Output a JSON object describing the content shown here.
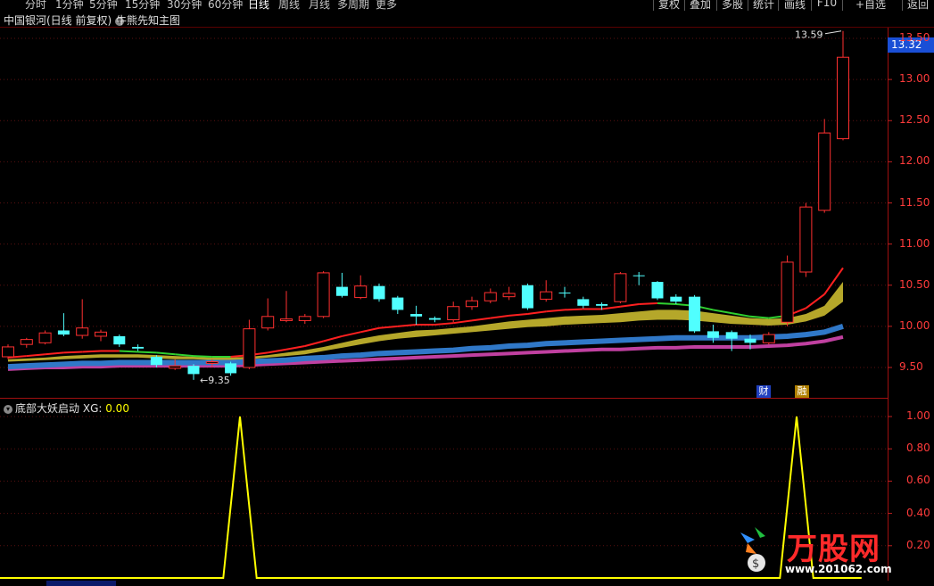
{
  "toolbar": {
    "periods": [
      "分时",
      "1分钟",
      "5分钟",
      "15分钟",
      "30分钟",
      "60分钟",
      "日线",
      "周线",
      "月线",
      "多周期",
      "更多"
    ],
    "active_period": "日线",
    "right_buttons": [
      "复权",
      "叠加",
      "多股",
      "统计",
      "画线",
      "F10",
      "+自选",
      "返回"
    ]
  },
  "main_title": "中国银河(日线 前复权)",
  "indicator_name": "牛熊先知主图",
  "price_axis": {
    "labels": [
      "13.50",
      "13.00",
      "12.50",
      "12.00",
      "11.50",
      "11.00",
      "10.50",
      "10.00",
      "9.50"
    ],
    "current_price": "13.32",
    "color": "#ff3b3b"
  },
  "annotations": {
    "high_label": "13.59",
    "low_label": "9.35",
    "tag_cai": "财",
    "tag_rong": "融"
  },
  "sub_indicator": {
    "name": "底部大妖启动",
    "xg_label": "XG:",
    "xg_value": "0.00",
    "axis_labels": [
      "1.00",
      "0.80",
      "0.60",
      "0.40",
      "0.20"
    ]
  },
  "watermark": {
    "brand": "万股网",
    "url": "www.201062.com"
  },
  "chart_data": {
    "type": "candlestick",
    "ylim": [
      9.3,
      13.65
    ],
    "candles": [
      {
        "o": 9.63,
        "c": 9.75,
        "h": 9.78,
        "l": 9.6,
        "up": true
      },
      {
        "o": 9.78,
        "c": 9.84,
        "h": 9.86,
        "l": 9.74,
        "up": true
      },
      {
        "o": 9.8,
        "c": 9.92,
        "h": 9.95,
        "l": 9.78,
        "up": true
      },
      {
        "o": 9.95,
        "c": 9.9,
        "h": 10.16,
        "l": 9.88,
        "up": false
      },
      {
        "o": 9.89,
        "c": 9.98,
        "h": 10.33,
        "l": 9.85,
        "up": true
      },
      {
        "o": 9.88,
        "c": 9.93,
        "h": 9.96,
        "l": 9.82,
        "up": true
      },
      {
        "o": 9.88,
        "c": 9.78,
        "h": 9.9,
        "l": 9.75,
        "up": false
      },
      {
        "o": 9.75,
        "c": 9.73,
        "h": 9.78,
        "l": 9.7,
        "up": false
      },
      {
        "o": 9.63,
        "c": 9.53,
        "h": 9.65,
        "l": 9.5,
        "up": false
      },
      {
        "o": 9.49,
        "c": 9.52,
        "h": 9.6,
        "l": 9.47,
        "up": true
      },
      {
        "o": 9.52,
        "c": 9.42,
        "h": 9.54,
        "l": 9.35,
        "up": false
      },
      {
        "o": 9.55,
        "c": 9.57,
        "h": 9.6,
        "l": 9.5,
        "up": true
      },
      {
        "o": 9.55,
        "c": 9.43,
        "h": 9.57,
        "l": 9.4,
        "up": false
      },
      {
        "o": 9.5,
        "c": 9.97,
        "h": 10.08,
        "l": 9.48,
        "up": true
      },
      {
        "o": 9.98,
        "c": 10.12,
        "h": 10.34,
        "l": 9.95,
        "up": true
      },
      {
        "o": 10.07,
        "c": 10.09,
        "h": 10.43,
        "l": 10.05,
        "up": true
      },
      {
        "o": 10.07,
        "c": 10.12,
        "h": 10.15,
        "l": 10.03,
        "up": true
      },
      {
        "o": 10.12,
        "c": 10.65,
        "h": 10.67,
        "l": 10.1,
        "up": true
      },
      {
        "o": 10.48,
        "c": 10.37,
        "h": 10.65,
        "l": 10.35,
        "up": false
      },
      {
        "o": 10.35,
        "c": 10.49,
        "h": 10.62,
        "l": 10.33,
        "up": true
      },
      {
        "o": 10.49,
        "c": 10.33,
        "h": 10.52,
        "l": 10.3,
        "up": false
      },
      {
        "o": 10.35,
        "c": 10.2,
        "h": 10.37,
        "l": 10.15,
        "up": false
      },
      {
        "o": 10.15,
        "c": 10.12,
        "h": 10.25,
        "l": 10.02,
        "up": false
      },
      {
        "o": 10.1,
        "c": 10.08,
        "h": 10.12,
        "l": 10.05,
        "up": false
      },
      {
        "o": 10.08,
        "c": 10.24,
        "h": 10.3,
        "l": 10.05,
        "up": true
      },
      {
        "o": 10.24,
        "c": 10.31,
        "h": 10.36,
        "l": 10.2,
        "up": true
      },
      {
        "o": 10.31,
        "c": 10.41,
        "h": 10.46,
        "l": 10.28,
        "up": true
      },
      {
        "o": 10.36,
        "c": 10.4,
        "h": 10.48,
        "l": 10.32,
        "up": true
      },
      {
        "o": 10.5,
        "c": 10.22,
        "h": 10.52,
        "l": 10.2,
        "up": false
      },
      {
        "o": 10.33,
        "c": 10.42,
        "h": 10.56,
        "l": 10.3,
        "up": true
      },
      {
        "o": 10.41,
        "c": 10.41,
        "h": 10.48,
        "l": 10.35,
        "up": false
      },
      {
        "o": 10.33,
        "c": 10.25,
        "h": 10.36,
        "l": 10.22,
        "up": false
      },
      {
        "o": 10.27,
        "c": 10.25,
        "h": 10.29,
        "l": 10.2,
        "up": false
      },
      {
        "o": 10.3,
        "c": 10.64,
        "h": 10.66,
        "l": 10.28,
        "up": true
      },
      {
        "o": 10.62,
        "c": 10.62,
        "h": 10.66,
        "l": 10.5,
        "up": false
      },
      {
        "o": 10.54,
        "c": 10.34,
        "h": 10.55,
        "l": 10.32,
        "up": false
      },
      {
        "o": 10.36,
        "c": 10.3,
        "h": 10.39,
        "l": 10.27,
        "up": false
      },
      {
        "o": 10.36,
        "c": 9.94,
        "h": 10.38,
        "l": 9.92,
        "up": false
      },
      {
        "o": 9.94,
        "c": 9.86,
        "h": 10.02,
        "l": 9.8,
        "up": false
      },
      {
        "o": 9.93,
        "c": 9.85,
        "h": 9.95,
        "l": 9.7,
        "up": false
      },
      {
        "o": 9.85,
        "c": 9.8,
        "h": 9.9,
        "l": 9.72,
        "up": false
      },
      {
        "o": 9.8,
        "c": 9.9,
        "h": 9.93,
        "l": 9.78,
        "up": true
      },
      {
        "o": 10.05,
        "c": 10.78,
        "h": 10.86,
        "l": 10.0,
        "up": true
      },
      {
        "o": 10.66,
        "c": 11.45,
        "h": 11.5,
        "l": 10.6,
        "up": true
      },
      {
        "o": 11.41,
        "c": 12.35,
        "h": 12.52,
        "l": 11.38,
        "up": true
      },
      {
        "o": 12.28,
        "c": 13.27,
        "h": 13.59,
        "l": 12.26,
        "up": true
      }
    ],
    "ma_red": [
      9.62,
      9.64,
      9.66,
      9.68,
      9.69,
      9.7,
      9.7,
      9.69,
      9.68,
      9.66,
      9.64,
      9.63,
      9.63,
      9.65,
      9.68,
      9.72,
      9.76,
      9.82,
      9.88,
      9.93,
      9.98,
      10.0,
      10.02,
      10.02,
      10.04,
      10.07,
      10.1,
      10.13,
      10.15,
      10.18,
      10.2,
      10.21,
      10.21,
      10.24,
      10.27,
      10.28,
      10.27,
      10.25,
      10.2,
      10.16,
      10.12,
      10.1,
      10.13,
      10.22,
      10.39,
      10.71
    ],
    "band_top": [
      9.6,
      9.61,
      9.62,
      9.64,
      9.65,
      9.66,
      9.66,
      9.66,
      9.65,
      9.64,
      9.63,
      9.62,
      9.62,
      9.63,
      9.65,
      9.68,
      9.71,
      9.75,
      9.8,
      9.85,
      9.89,
      9.92,
      9.95,
      9.96,
      9.98,
      10.0,
      10.03,
      10.06,
      10.08,
      10.1,
      10.12,
      10.13,
      10.14,
      10.16,
      10.18,
      10.2,
      10.2,
      10.19,
      10.16,
      10.13,
      10.1,
      10.09,
      10.1,
      10.15,
      10.25,
      10.54
    ],
    "band_bot": [
      9.57,
      9.58,
      9.59,
      9.6,
      9.61,
      9.62,
      9.62,
      9.62,
      9.61,
      9.6,
      9.6,
      9.59,
      9.59,
      9.6,
      9.62,
      9.64,
      9.66,
      9.7,
      9.74,
      9.78,
      9.82,
      9.85,
      9.87,
      9.89,
      9.91,
      9.93,
      9.95,
      9.97,
      9.99,
      10.0,
      10.02,
      10.03,
      10.04,
      10.05,
      10.07,
      10.08,
      10.08,
      10.07,
      10.05,
      10.03,
      10.02,
      10.01,
      10.02,
      10.06,
      10.13,
      10.3
    ],
    "ma_blue": [
      9.51,
      9.52,
      9.53,
      9.54,
      9.55,
      9.55,
      9.56,
      9.56,
      9.56,
      9.56,
      9.56,
      9.56,
      9.56,
      9.57,
      9.58,
      9.59,
      9.61,
      9.62,
      9.64,
      9.65,
      9.67,
      9.68,
      9.69,
      9.7,
      9.71,
      9.73,
      9.74,
      9.76,
      9.77,
      9.79,
      9.8,
      9.81,
      9.82,
      9.83,
      9.84,
      9.85,
      9.86,
      9.86,
      9.86,
      9.86,
      9.86,
      9.87,
      9.88,
      9.9,
      9.93,
      10.0
    ],
    "ma_magenta": [
      9.48,
      9.49,
      9.5,
      9.5,
      9.51,
      9.51,
      9.52,
      9.52,
      9.52,
      9.52,
      9.52,
      9.52,
      9.52,
      9.53,
      9.54,
      9.55,
      9.56,
      9.57,
      9.58,
      9.59,
      9.6,
      9.61,
      9.62,
      9.63,
      9.64,
      9.65,
      9.66,
      9.67,
      9.68,
      9.69,
      9.7,
      9.71,
      9.72,
      9.72,
      9.73,
      9.74,
      9.74,
      9.75,
      9.75,
      9.75,
      9.75,
      9.76,
      9.77,
      9.79,
      9.82,
      9.87
    ],
    "green_ranges": [
      [
        6,
        12
      ],
      [
        35,
        42
      ]
    ],
    "xg": {
      "ylim": [
        0,
        1.05
      ],
      "values_x_day_index": [
        0,
        12,
        13,
        14,
        41,
        42,
        43
      ],
      "points": [
        [
          -0.6,
          0
        ],
        [
          11.6,
          0
        ],
        [
          12.5,
          1
        ],
        [
          13.4,
          0
        ],
        [
          41.6,
          0
        ],
        [
          42.5,
          1
        ],
        [
          43.4,
          0
        ],
        [
          46.0,
          0
        ]
      ]
    }
  }
}
